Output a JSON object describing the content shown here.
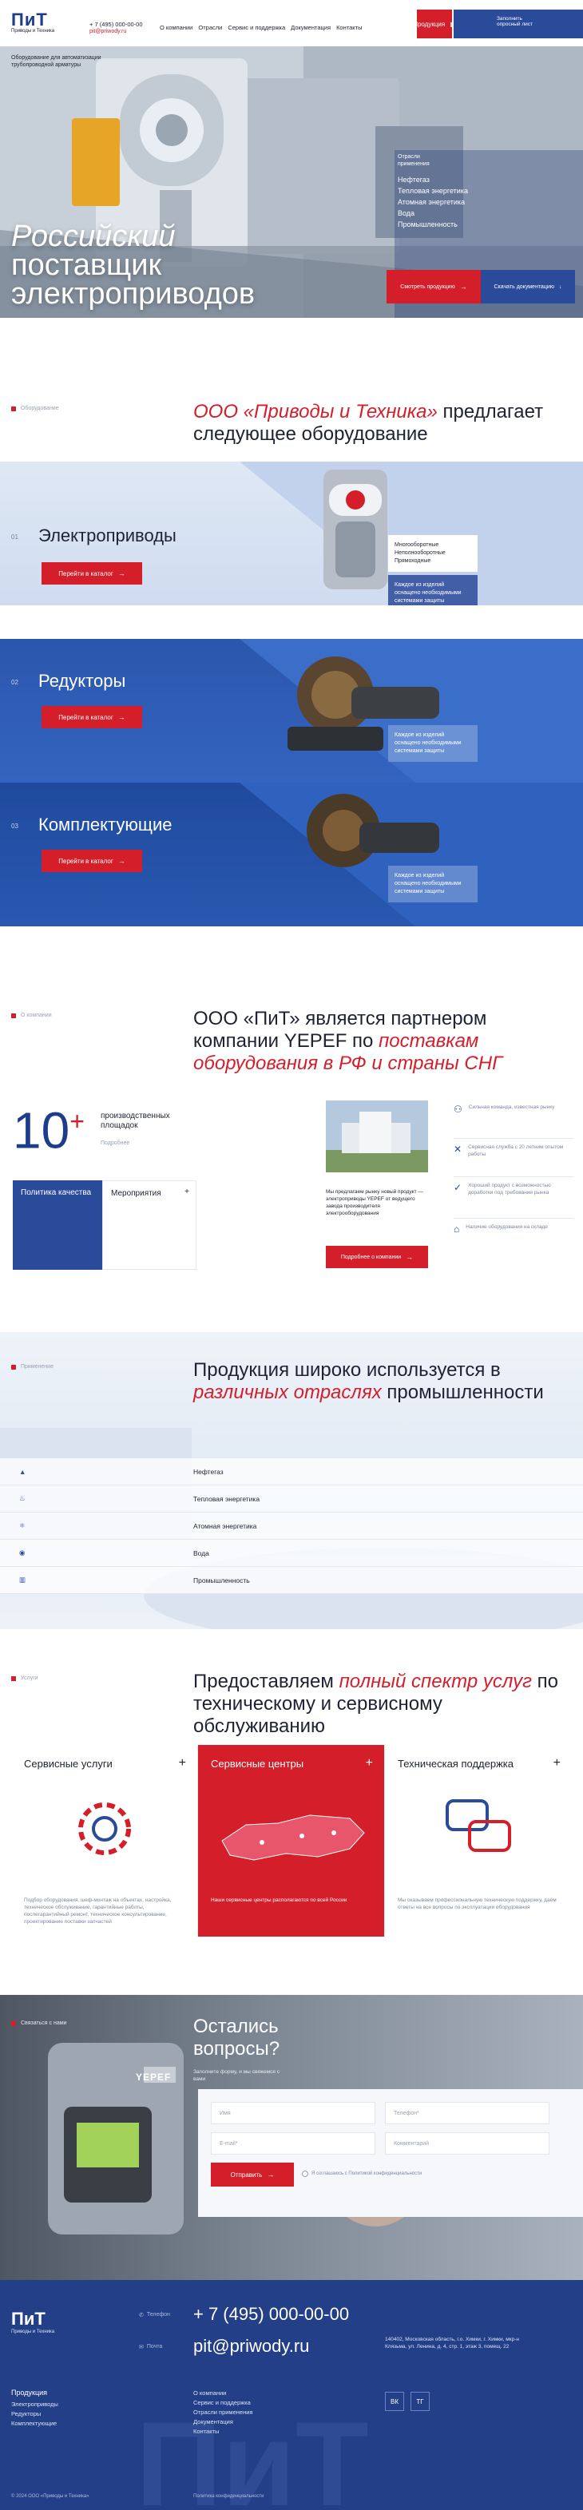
{
  "header": {
    "logo_main": "ПиТ",
    "logo_sub": "Приводы и Техника",
    "phone": "+ 7 (495) 000-00-00",
    "email": "pit@priwody.ru",
    "nav": [
      "О компании",
      "Отрасли",
      "Сервис и поддержка",
      "Документация",
      "Контакты"
    ],
    "products_btn": "Продукция",
    "request_btn": "Заполнить опросный лист"
  },
  "hero": {
    "tagline": "Оборудование для автоматизации трубопроводной арматуры",
    "title_line1": "Российский",
    "title_line2": "поставщик",
    "title_line3": "электроприводов",
    "industries_label": "Отрасли применения",
    "industries": [
      "Нефтегаз",
      "Тепловая энергетика",
      "Атомная энергетика",
      "Вода",
      "Промышленность"
    ],
    "btn_products": "Смотреть продукцию",
    "btn_docs": "Скачать документацию"
  },
  "equipment": {
    "section_label": "Оборудование",
    "title_prefix": "ООО «Приводы и Техника»",
    "title_suffix": " предлагает следующее оборудование",
    "items": [
      {
        "num": "01",
        "title": "Электроприводы",
        "btn": "Перейти в каталог",
        "types": [
          "Многооборотные",
          "Неполнооборотные",
          "Прямоходные"
        ],
        "note": "Каждое из изделий оснащено необходимыми системами защиты"
      },
      {
        "num": "02",
        "title": "Редукторы",
        "btn": "Перейти в каталог",
        "note": "Каждое из изделий оснащено необходимыми системами защиты"
      },
      {
        "num": "03",
        "title": "Комплектующие",
        "btn": "Перейти в каталог",
        "note": "Каждое из изделий оснащено необходимыми системами защиты"
      }
    ]
  },
  "partner": {
    "section_label": "О компании",
    "title_a": "ООО «ПиТ» является партнером компании YEPEF по ",
    "title_b": "поставкам оборудования в РФ и страны СНГ",
    "stat_num": "10",
    "stat_plus": "+",
    "stat_text": "производственных площадок",
    "stat_more": "Подробнее",
    "tile_quality": "Политика качества",
    "tile_events": "Мероприятия",
    "about_text": "Мы предлагаем рынку новый продукт — электроприводы YEPEF от ведущего завода производителя электрооборудования",
    "about_btn": "Подробнее о компании",
    "features": [
      "Сильная команда, известная рынку",
      "Сервисная служба с 20 летним опытом работы",
      "Хороший продукт с возможностью доработки под требования рынка",
      "Наличие оборудования на складе"
    ]
  },
  "industries": {
    "section_label": "Применение",
    "title_a": "Продукция широко используется в ",
    "title_b": "различных отраслях",
    "title_c": " промышленности",
    "rows": [
      "Нефтегаз",
      "Тепловая энергетика",
      "Атомная энергетика",
      "Вода",
      "Промышленность"
    ]
  },
  "services": {
    "section_label": "Услуги",
    "title_a": "Предоставляем ",
    "title_b": "полный спектр услуг",
    "title_c": " по техническому и сервисному обслуживанию",
    "cards": [
      {
        "title": "Сервисные услуги",
        "text": "Подбор оборудования, шеф-монтаж на объектах, настройка, техническое обслуживание, гарантийные работы, послегарантийный ремонт, техническое консультирование, проектирование поставки запчастей"
      },
      {
        "title": "Сервисные центры",
        "text": "Наши сервисные центры располагаются по всей России"
      },
      {
        "title": "Техническая поддержка",
        "text": "Мы оказываем профессиональную техническую поддержку, даём ответы на все вопросы по эксплуатации оборудования"
      }
    ]
  },
  "contact": {
    "section_label": "Связаться с нами",
    "title": "Остались вопросы?",
    "subtitle": "Заполните форму, и мы свяжемся с вами",
    "brand_plate": "YEPEF",
    "name_ph": "Имя",
    "phone_ph": "Телефон*",
    "email_ph": "E-mail*",
    "comment_ph": "Комментарий",
    "submit": "Отправить",
    "consent": "Я соглашаюсь с Политикой конфиденциальности"
  },
  "footer": {
    "logo_main": "ПиТ",
    "logo_sub": "Приводы и Техника",
    "phone_label": "Телефон",
    "phone": "+ 7 (495) 000-00-00",
    "mail_label": "Почта",
    "email": "pit@priwody.ru",
    "address": "140402, Московская область, г.о. Химки, г. Химки, мкр-н Клязьма, ул. Ленина, д. 4, стр. 1, этаж 3, помещ. 22",
    "col1_title": "Продукция",
    "col1": [
      "Электроприводы",
      "Редукторы",
      "Комплектующие"
    ],
    "col2": [
      "О компании",
      "Сервис и поддержка",
      "Отрасли применения",
      "Документация",
      "Контакты"
    ],
    "social": [
      "ВК",
      "ТГ"
    ],
    "copyright": "© 2024 ООО «Приводы и Техника»",
    "policy": "Политика конфиденциальности",
    "big_mark": "ПиТ"
  }
}
